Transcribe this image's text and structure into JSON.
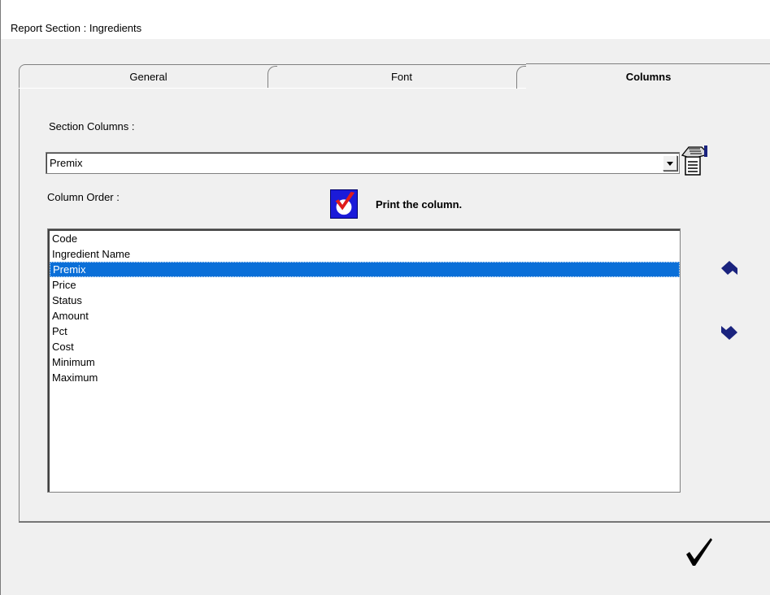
{
  "window": {
    "title": "Report Section : Ingredients"
  },
  "tabs": [
    {
      "label": "General",
      "active": false
    },
    {
      "label": "Font",
      "active": false
    },
    {
      "label": "Columns",
      "active": true
    }
  ],
  "section_columns": {
    "label": "Section Columns :",
    "selected_value": "Premix"
  },
  "column_order": {
    "label": "Column Order :",
    "print_label": "Print the column.",
    "items": [
      "Code",
      "Ingredient Name",
      "Premix",
      "Price",
      "Status",
      "Amount",
      "Pct",
      "Cost",
      "Minimum",
      "Maximum"
    ],
    "selected_index": 2
  },
  "icons": {
    "print_settings": "hand-document-icon",
    "print_check": "checkmark-icon",
    "move_up": "arrow-up-icon",
    "move_down": "arrow-down-icon",
    "ok": "checkmark-icon"
  },
  "colors": {
    "selection": "#0a6fd8",
    "arrow": "#1a237e",
    "check_bg": "#1b1bd9",
    "check_mark": "#e01b1b"
  }
}
